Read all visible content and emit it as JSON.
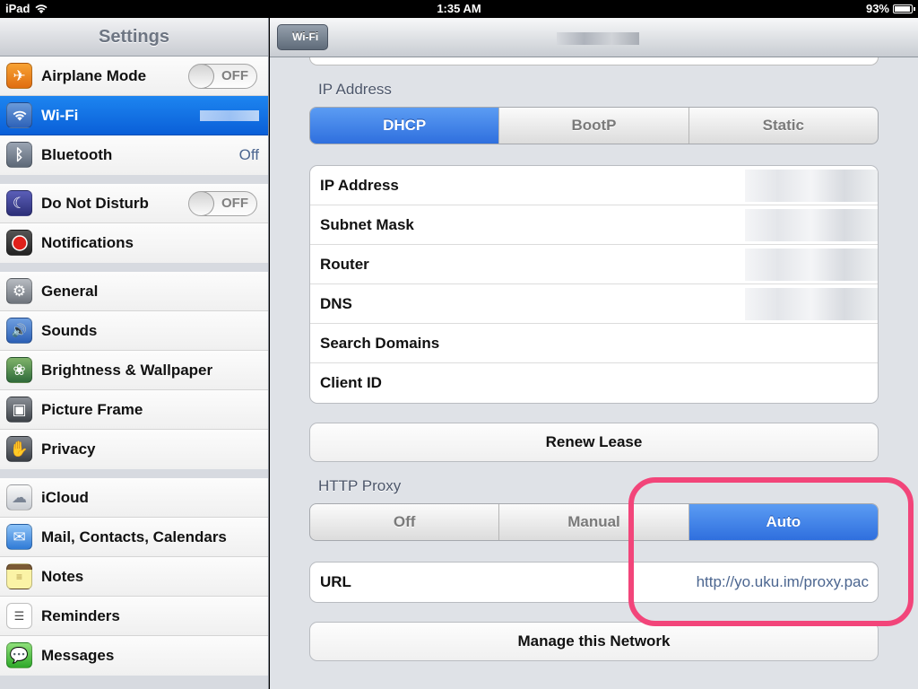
{
  "statusbar": {
    "device": "iPad",
    "time": "1:35 AM",
    "battery": "93%",
    "battery_level": 0.93
  },
  "sidebar": {
    "title": "Settings",
    "groups": [
      [
        {
          "label": "Airplane Mode",
          "icon": "airplane-icon",
          "toggle": "OFF"
        },
        {
          "label": "Wi-Fi",
          "icon": "wifi-icon",
          "selected": true
        },
        {
          "label": "Bluetooth",
          "icon": "bluetooth-icon",
          "value": "Off"
        }
      ],
      [
        {
          "label": "Do Not Disturb",
          "icon": "moon-icon",
          "toggle": "OFF"
        },
        {
          "label": "Notifications",
          "icon": "notifications-icon"
        }
      ],
      [
        {
          "label": "General",
          "icon": "gear-icon"
        },
        {
          "label": "Sounds",
          "icon": "speaker-icon"
        },
        {
          "label": "Brightness & Wallpaper",
          "icon": "flower-icon"
        },
        {
          "label": "Picture Frame",
          "icon": "picture-frame-icon"
        },
        {
          "label": "Privacy",
          "icon": "hand-icon"
        }
      ],
      [
        {
          "label": "iCloud",
          "icon": "cloud-icon"
        },
        {
          "label": "Mail, Contacts, Calendars",
          "icon": "mail-icon"
        },
        {
          "label": "Notes",
          "icon": "notes-icon"
        },
        {
          "label": "Reminders",
          "icon": "reminders-icon"
        },
        {
          "label": "Messages",
          "icon": "messages-icon"
        }
      ]
    ]
  },
  "navbar": {
    "back_label": "Wi-Fi"
  },
  "ip_address": {
    "section_label": "IP Address",
    "segments": [
      "DHCP",
      "BootP",
      "Static"
    ],
    "active_segment": "DHCP",
    "rows": [
      "IP Address",
      "Subnet Mask",
      "Router",
      "DNS",
      "Search Domains",
      "Client ID"
    ]
  },
  "renew_lease": {
    "label": "Renew Lease"
  },
  "http_proxy": {
    "section_label": "HTTP Proxy",
    "segments": [
      "Off",
      "Manual",
      "Auto"
    ],
    "active_segment": "Auto",
    "url_label": "URL",
    "url_value": "http://yo.uku.im/proxy.pac"
  },
  "manage_network": {
    "label": "Manage this Network"
  },
  "colors": {
    "selected_blue": "#0a5fd8",
    "segment_active": "#2f6fde",
    "value_text": "#4c6690",
    "annotation": "#f2457a"
  }
}
